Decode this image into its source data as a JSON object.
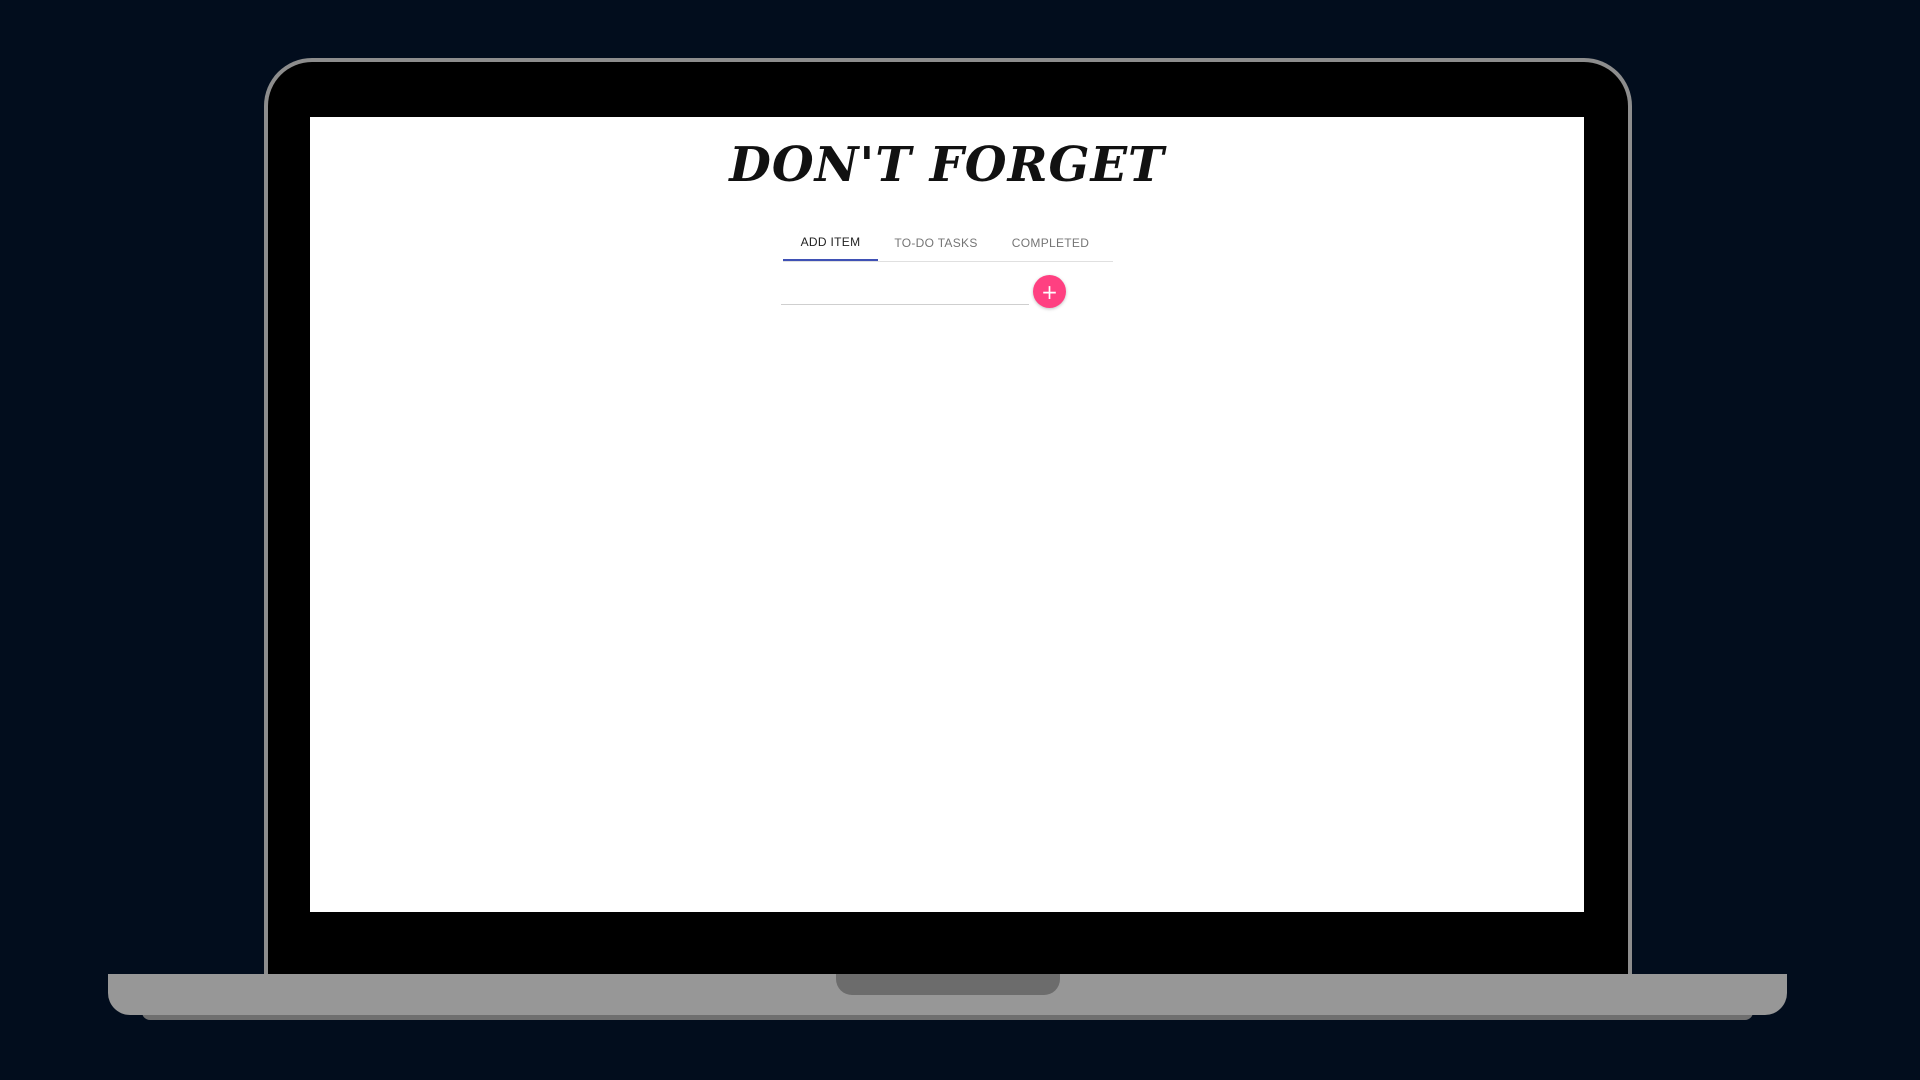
{
  "app": {
    "title": "DON'T FORGET"
  },
  "tabs": [
    {
      "label": "ADD ITEM",
      "active": true
    },
    {
      "label": "TO-DO TASKS",
      "active": false
    },
    {
      "label": "COMPLETED",
      "active": false
    }
  ],
  "add_item": {
    "input_value": "",
    "input_placeholder": "",
    "add_icon": "plus-icon",
    "add_symbol": "+"
  },
  "colors": {
    "background": "#020d1d",
    "tab_indicator": "#3f51b5",
    "add_button": "#ff4081"
  }
}
